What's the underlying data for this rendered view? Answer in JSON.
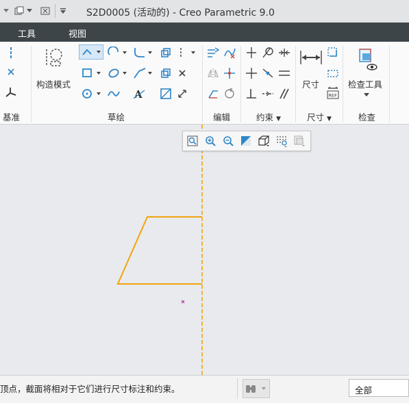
{
  "window": {
    "title": "S2D0005 (活动的) - Creo Parametric 9.0"
  },
  "menu": {
    "tools": "工具",
    "view": "视图"
  },
  "ribbon": {
    "groups": {
      "datum": "基准",
      "sketch": "草绘",
      "edit": "编辑",
      "constrain": "约束",
      "dimension": "尺寸",
      "inspect": "检查"
    },
    "construction_mode": "构造模式",
    "dimension_button": "尺寸",
    "inspect_tools": "检查工具"
  },
  "status": {
    "message": "顶点，截面将相对于它们进行尺寸标注和约束。",
    "filter": "全部"
  },
  "colors": {
    "sketch": "#f2a30f",
    "centerline": "#f2a30f",
    "point": "#b0308a",
    "menubar": "#3d4549"
  }
}
